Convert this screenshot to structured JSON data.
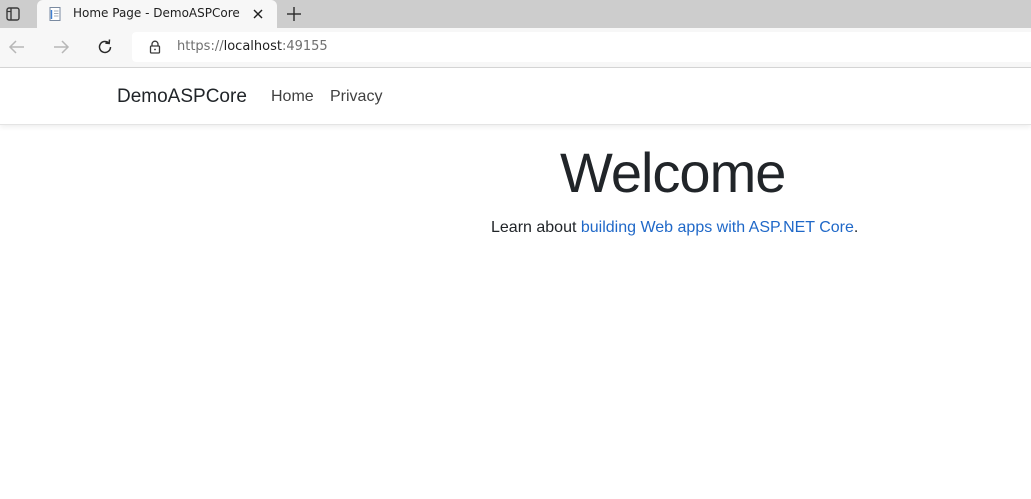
{
  "browser": {
    "tab": {
      "title": "Home Page - DemoASPCore"
    },
    "address": {
      "scheme": "https://",
      "host": "localhost",
      "port": ":49155"
    },
    "icons": {
      "tab_actions": "tab-actions-icon",
      "favicon": "page-icon",
      "close": "close-icon",
      "new_tab": "plus-icon",
      "back": "arrow-left-icon",
      "forward": "arrow-right-icon",
      "refresh": "refresh-icon",
      "lock": "lock-icon"
    }
  },
  "site": {
    "brand": "DemoASPCore",
    "nav": [
      "Home",
      "Privacy"
    ],
    "heading": "Welcome",
    "lead": {
      "prefix": "Learn about ",
      "link_text": "building Web apps with ASP.NET Core",
      "suffix": "."
    }
  },
  "colors": {
    "link": "#1f68c8",
    "text": "#212529",
    "chrome_bg": "#cdcdcd",
    "toolbar_bg": "#f7f7f7"
  }
}
